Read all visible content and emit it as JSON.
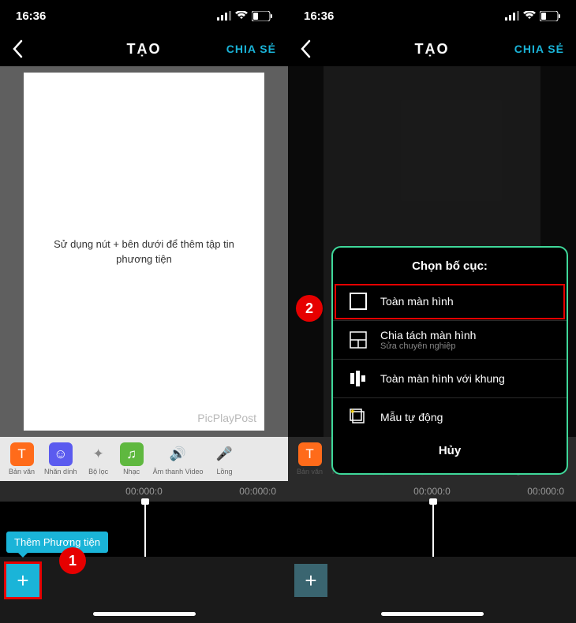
{
  "status": {
    "time": "16:36"
  },
  "nav": {
    "title": "TẠO",
    "share": "CHIA SẺ"
  },
  "left": {
    "canvas_text": "Sử dụng nút + bên dưới để thêm tập tin phương tiện",
    "watermark": "PicPlayPost",
    "tooltip": "Thêm Phương tiện"
  },
  "tools": {
    "text": "Bản văn",
    "sticker": "Nhãn dính",
    "filter": "Bộ lọc",
    "music": "Nhạc",
    "audio": "Âm thanh Video",
    "voice": "Lồng"
  },
  "timeline": {
    "tc1": "00:000:0",
    "tc2": "00:000:0"
  },
  "popup": {
    "title": "Chọn bố cục:",
    "opt1": "Toàn màn hình",
    "opt2": {
      "label": "Chia tách màn hình",
      "sub": "Sửa chuyên nghiệp"
    },
    "opt3": "Toàn màn hình với khung",
    "opt4": "Mẫu tự động",
    "cancel": "Hủy"
  },
  "steps": {
    "s1": "1",
    "s2": "2"
  }
}
